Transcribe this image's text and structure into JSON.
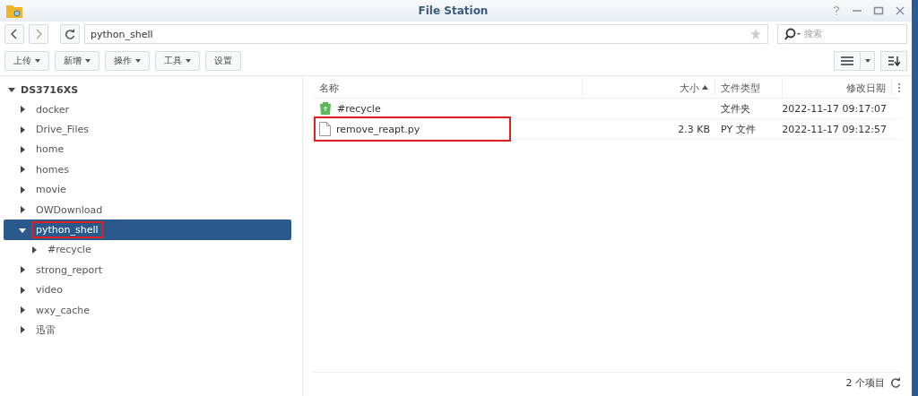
{
  "window": {
    "title": "File Station"
  },
  "address": {
    "path": "python_shell",
    "favorite": false
  },
  "search": {
    "placeholder": "搜索"
  },
  "toolbar": [
    {
      "label": "上传",
      "dropdown": true
    },
    {
      "label": "新增",
      "dropdown": true
    },
    {
      "label": "操作",
      "dropdown": true
    },
    {
      "label": "工具",
      "dropdown": true
    },
    {
      "label": "设置",
      "dropdown": false
    }
  ],
  "tree": {
    "root": "DS3716XS",
    "expanded": true,
    "children": [
      {
        "label": "docker",
        "expanded": false,
        "selected": false,
        "annotated": false
      },
      {
        "label": "Drive_Files",
        "expanded": false,
        "selected": false,
        "annotated": false
      },
      {
        "label": "home",
        "expanded": false,
        "selected": false,
        "annotated": false
      },
      {
        "label": "homes",
        "expanded": false,
        "selected": false,
        "annotated": false
      },
      {
        "label": "movie",
        "expanded": false,
        "selected": false,
        "annotated": false
      },
      {
        "label": "OWDownload",
        "expanded": false,
        "selected": false,
        "annotated": false
      },
      {
        "label": "python_shell",
        "expanded": true,
        "selected": true,
        "annotated": true,
        "children": [
          {
            "label": "#recycle",
            "expanded": false,
            "selected": false,
            "annotated": false
          }
        ]
      },
      {
        "label": "strong_report",
        "expanded": false,
        "selected": false,
        "annotated": false
      },
      {
        "label": "video",
        "expanded": false,
        "selected": false,
        "annotated": false
      },
      {
        "label": "wxy_cache",
        "expanded": false,
        "selected": false,
        "annotated": false
      },
      {
        "label": "迅雷",
        "expanded": false,
        "selected": false,
        "annotated": false
      }
    ]
  },
  "table": {
    "columns": [
      {
        "label": "名称",
        "sorted": false
      },
      {
        "label": "大小",
        "sorted": true
      },
      {
        "label": "文件类型",
        "sorted": false
      },
      {
        "label": "修改日期",
        "sorted": false
      }
    ],
    "rows": [
      {
        "kind": "folder",
        "name": "#recycle",
        "size": "",
        "type": "文件夹",
        "modified": "2022-11-17 09:17:07",
        "annotated": false
      },
      {
        "kind": "file",
        "name": "remove_reapt.py",
        "size": "2.3 KB",
        "type": "PY 文件",
        "modified": "2022-11-17 09:12:57",
        "annotated": true
      }
    ]
  },
  "status_bar": {
    "count": "2 个项目"
  }
}
